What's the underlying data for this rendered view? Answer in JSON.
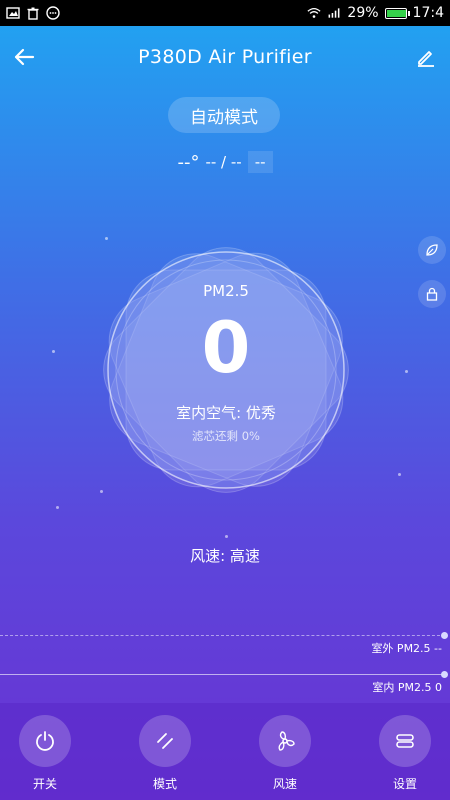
{
  "statusbar": {
    "battery": "29%",
    "time": "17:4"
  },
  "header": {
    "title": "P380D Air Purifier"
  },
  "mode": {
    "label": "自动模式"
  },
  "temperature": {
    "value": "--°",
    "middle": "-- / --",
    "boxed": "--"
  },
  "reading": {
    "label": "PM2.5",
    "value": "0",
    "air_quality": "室内空气: 优秀",
    "filter": "滤芯还剩 0%"
  },
  "fan": {
    "speed": "风速: 高速"
  },
  "trend": {
    "outdoor_label": "室外 PM2.5 --",
    "indoor_label": "室内 PM2.5 0"
  },
  "nav": {
    "items": [
      {
        "label": "开关",
        "icon": "power-icon"
      },
      {
        "label": "模式",
        "icon": "mode-icon"
      },
      {
        "label": "风速",
        "icon": "fan-icon"
      },
      {
        "label": "设置",
        "icon": "settings-icon"
      }
    ]
  }
}
